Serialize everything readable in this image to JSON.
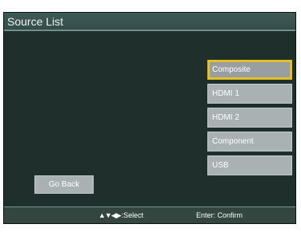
{
  "title": "Source List",
  "sources": [
    {
      "label": "Composite",
      "selected": true
    },
    {
      "label": "HDMI 1",
      "selected": false
    },
    {
      "label": "HDMI 2",
      "selected": false
    },
    {
      "label": "Component",
      "selected": false
    },
    {
      "label": "USB",
      "selected": false
    }
  ],
  "go_back_label": "Go Back",
  "footer": {
    "nav_icons": "▲▼◀▶",
    "nav_label": ":Select",
    "confirm_label": "Enter: Confirm"
  },
  "colors": {
    "background": "#1e2f2c",
    "title_bar": "#3e5a55",
    "button": "#a9b1b3",
    "selected_border": "#e3c023",
    "footer": "#33463f"
  }
}
